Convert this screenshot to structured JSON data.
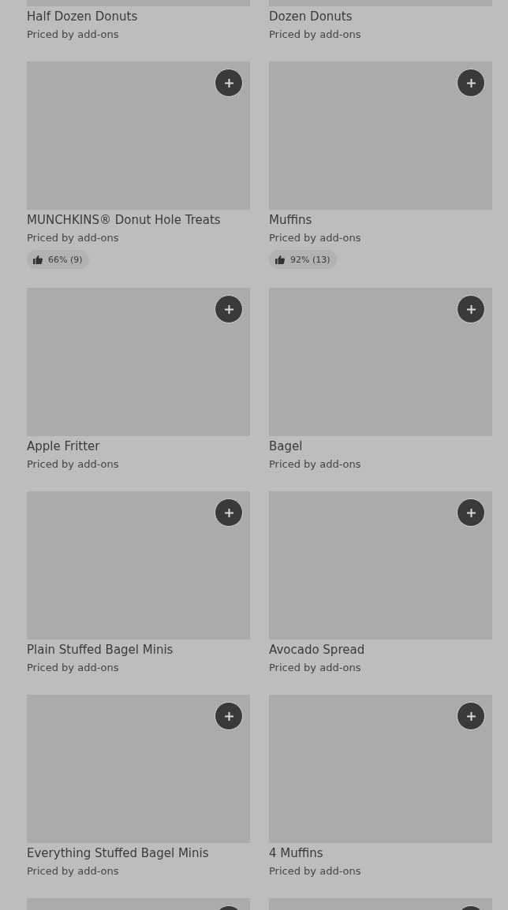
{
  "menu_items": [
    {
      "kind": "image_cut_top",
      "name": "Half Dozen Donuts",
      "price": "Priced by add-ons"
    },
    {
      "kind": "image_cut_top",
      "name": "Dozen Donuts",
      "price": "Priced by add-ons"
    },
    {
      "kind": "item",
      "name": "MUNCHKINS® Donut Hole Treats",
      "price": "Priced by add-ons",
      "rating": "66% (9)"
    },
    {
      "kind": "item",
      "name": "Muffins",
      "price": "Priced by add-ons",
      "rating": "92% (13)"
    },
    {
      "kind": "item",
      "name": "Apple Fritter",
      "price": "Priced by add-ons"
    },
    {
      "kind": "item",
      "name": "Bagel",
      "price": "Priced by add-ons"
    },
    {
      "kind": "item",
      "name": "Plain Stuffed Bagel Minis",
      "price": "Priced by add-ons"
    },
    {
      "kind": "item",
      "name": "Avocado Spread",
      "price": "Priced by add-ons"
    },
    {
      "kind": "item",
      "name": "Everything Stuffed Bagel Minis",
      "price": "Priced by add-ons"
    },
    {
      "kind": "item",
      "name": "4 Muffins",
      "price": "Priced by add-ons"
    },
    {
      "kind": "cut"
    },
    {
      "kind": "cut"
    }
  ]
}
